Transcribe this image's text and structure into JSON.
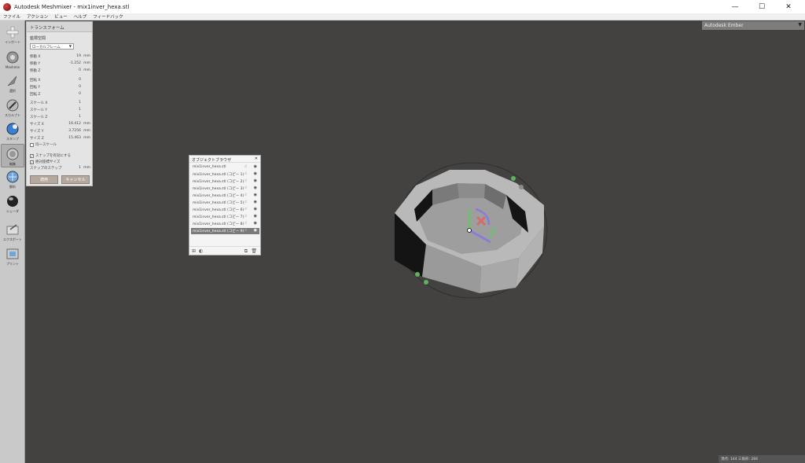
{
  "window": {
    "title": "Autodesk Meshmixer - mix1inver_hexa.stl",
    "controls": [
      "—",
      "☐",
      "✕"
    ]
  },
  "menu": [
    "ファイル",
    "アクション",
    "ビュー",
    "ヘルプ",
    "フィードバック"
  ],
  "toolbar": [
    {
      "label": "インポート",
      "icon": "plus-icon"
    },
    {
      "label": "Meshmix",
      "icon": "meshmix-icon"
    },
    {
      "label": "選択",
      "icon": "select-arrow-icon"
    },
    {
      "label": "スカルプト",
      "icon": "brush-icon"
    },
    {
      "label": "スタンプ",
      "icon": "stamp-icon"
    },
    {
      "label": "編集",
      "icon": "edit-icon"
    },
    {
      "label": "解析",
      "icon": "analysis-icon"
    },
    {
      "label": "シェーダ",
      "icon": "shader-sphere-icon"
    },
    {
      "label": "エクスポート",
      "icon": "export-icon"
    },
    {
      "label": "プリント",
      "icon": "print-icon"
    }
  ],
  "transform": {
    "header": "トランスフォーム",
    "coord_label": "座標空間",
    "coord_value": "ローカルフレーム",
    "rows": [
      {
        "k": "移動 X",
        "v": "19",
        "u": "mm"
      },
      {
        "k": "移動 Y",
        "v": "-1.252",
        "u": "mm"
      },
      {
        "k": "移動 Z",
        "v": "0",
        "u": "mm"
      },
      {
        "k": "回転 X",
        "v": "0",
        "u": ""
      },
      {
        "k": "回転 Y",
        "v": "0",
        "u": ""
      },
      {
        "k": "回転 Z",
        "v": "0",
        "u": ""
      },
      {
        "k": "スケール X",
        "v": "1",
        "u": ""
      },
      {
        "k": "スケール Y",
        "v": "1",
        "u": ""
      },
      {
        "k": "スケール Z",
        "v": "1",
        "u": ""
      },
      {
        "k": "サイズ X",
        "v": "16.412",
        "u": "mm"
      },
      {
        "k": "サイズ Y",
        "v": "3.7256",
        "u": "mm"
      },
      {
        "k": "サイズ Z",
        "v": "15.463",
        "u": "mm"
      }
    ],
    "uniform_scale": "均一スケール",
    "snap_enable": "スナップを有効にする",
    "world_size": "絶対座標サイズ",
    "snap_step_label": "スナップのステップ",
    "snap_step_value": "1",
    "snap_step_unit": "mm",
    "apply": "適用",
    "cancel": "キャンセル"
  },
  "object_browser": {
    "title": "オブジェクトブラウザ",
    "close": "✕",
    "items": [
      "mix1inver_hexa.stl",
      "mix1inver_hexa.stl (コピー 1)",
      "mix1inver_hexa.stl (コピー 2)",
      "mix1inver_hexa.stl (コピー 3)",
      "mix1inver_hexa.stl (コピー 4)",
      "mix1inver_hexa.stl (コピー 5)",
      "mix1inver_hexa.stl (コピー 6)",
      "mix1inver_hexa.stl (コピー 7)",
      "mix1inver_hexa.stl (コピー 8)",
      "mix1inver_hexa.stl (コピー 9)"
    ],
    "selected_index": 9
  },
  "ember": {
    "label": "Autodesk Ember",
    "arrow": "▼"
  },
  "status": "頂点: 144 三角形: 284"
}
